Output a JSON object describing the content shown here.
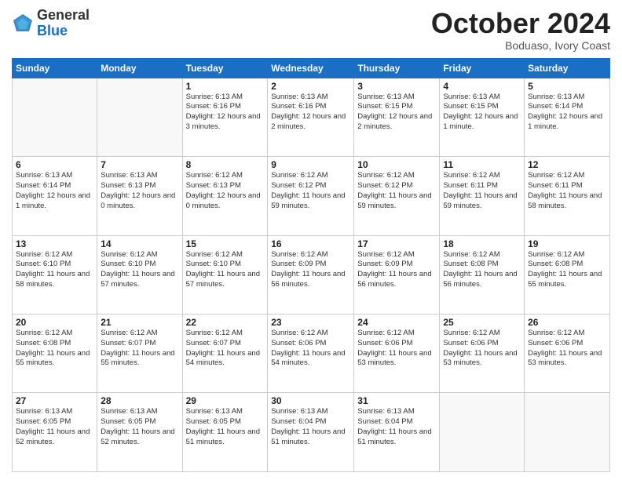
{
  "header": {
    "logo_general": "General",
    "logo_blue": "Blue",
    "month_title": "October 2024",
    "subtitle": "Boduaso, Ivory Coast"
  },
  "weekdays": [
    "Sunday",
    "Monday",
    "Tuesday",
    "Wednesday",
    "Thursday",
    "Friday",
    "Saturday"
  ],
  "weeks": [
    [
      {
        "day": "",
        "info": ""
      },
      {
        "day": "",
        "info": ""
      },
      {
        "day": "1",
        "info": "Sunrise: 6:13 AM\nSunset: 6:16 PM\nDaylight: 12 hours and 3 minutes."
      },
      {
        "day": "2",
        "info": "Sunrise: 6:13 AM\nSunset: 6:16 PM\nDaylight: 12 hours and 2 minutes."
      },
      {
        "day": "3",
        "info": "Sunrise: 6:13 AM\nSunset: 6:15 PM\nDaylight: 12 hours and 2 minutes."
      },
      {
        "day": "4",
        "info": "Sunrise: 6:13 AM\nSunset: 6:15 PM\nDaylight: 12 hours and 1 minute."
      },
      {
        "day": "5",
        "info": "Sunrise: 6:13 AM\nSunset: 6:14 PM\nDaylight: 12 hours and 1 minute."
      }
    ],
    [
      {
        "day": "6",
        "info": "Sunrise: 6:13 AM\nSunset: 6:14 PM\nDaylight: 12 hours and 1 minute."
      },
      {
        "day": "7",
        "info": "Sunrise: 6:13 AM\nSunset: 6:13 PM\nDaylight: 12 hours and 0 minutes."
      },
      {
        "day": "8",
        "info": "Sunrise: 6:12 AM\nSunset: 6:13 PM\nDaylight: 12 hours and 0 minutes."
      },
      {
        "day": "9",
        "info": "Sunrise: 6:12 AM\nSunset: 6:12 PM\nDaylight: 11 hours and 59 minutes."
      },
      {
        "day": "10",
        "info": "Sunrise: 6:12 AM\nSunset: 6:12 PM\nDaylight: 11 hours and 59 minutes."
      },
      {
        "day": "11",
        "info": "Sunrise: 6:12 AM\nSunset: 6:11 PM\nDaylight: 11 hours and 59 minutes."
      },
      {
        "day": "12",
        "info": "Sunrise: 6:12 AM\nSunset: 6:11 PM\nDaylight: 11 hours and 58 minutes."
      }
    ],
    [
      {
        "day": "13",
        "info": "Sunrise: 6:12 AM\nSunset: 6:10 PM\nDaylight: 11 hours and 58 minutes."
      },
      {
        "day": "14",
        "info": "Sunrise: 6:12 AM\nSunset: 6:10 PM\nDaylight: 11 hours and 57 minutes."
      },
      {
        "day": "15",
        "info": "Sunrise: 6:12 AM\nSunset: 6:10 PM\nDaylight: 11 hours and 57 minutes."
      },
      {
        "day": "16",
        "info": "Sunrise: 6:12 AM\nSunset: 6:09 PM\nDaylight: 11 hours and 56 minutes."
      },
      {
        "day": "17",
        "info": "Sunrise: 6:12 AM\nSunset: 6:09 PM\nDaylight: 11 hours and 56 minutes."
      },
      {
        "day": "18",
        "info": "Sunrise: 6:12 AM\nSunset: 6:08 PM\nDaylight: 11 hours and 56 minutes."
      },
      {
        "day": "19",
        "info": "Sunrise: 6:12 AM\nSunset: 6:08 PM\nDaylight: 11 hours and 55 minutes."
      }
    ],
    [
      {
        "day": "20",
        "info": "Sunrise: 6:12 AM\nSunset: 6:08 PM\nDaylight: 11 hours and 55 minutes."
      },
      {
        "day": "21",
        "info": "Sunrise: 6:12 AM\nSunset: 6:07 PM\nDaylight: 11 hours and 55 minutes."
      },
      {
        "day": "22",
        "info": "Sunrise: 6:12 AM\nSunset: 6:07 PM\nDaylight: 11 hours and 54 minutes."
      },
      {
        "day": "23",
        "info": "Sunrise: 6:12 AM\nSunset: 6:06 PM\nDaylight: 11 hours and 54 minutes."
      },
      {
        "day": "24",
        "info": "Sunrise: 6:12 AM\nSunset: 6:06 PM\nDaylight: 11 hours and 53 minutes."
      },
      {
        "day": "25",
        "info": "Sunrise: 6:12 AM\nSunset: 6:06 PM\nDaylight: 11 hours and 53 minutes."
      },
      {
        "day": "26",
        "info": "Sunrise: 6:12 AM\nSunset: 6:06 PM\nDaylight: 11 hours and 53 minutes."
      }
    ],
    [
      {
        "day": "27",
        "info": "Sunrise: 6:13 AM\nSunset: 6:05 PM\nDaylight: 11 hours and 52 minutes."
      },
      {
        "day": "28",
        "info": "Sunrise: 6:13 AM\nSunset: 6:05 PM\nDaylight: 11 hours and 52 minutes."
      },
      {
        "day": "29",
        "info": "Sunrise: 6:13 AM\nSunset: 6:05 PM\nDaylight: 11 hours and 51 minutes."
      },
      {
        "day": "30",
        "info": "Sunrise: 6:13 AM\nSunset: 6:04 PM\nDaylight: 11 hours and 51 minutes."
      },
      {
        "day": "31",
        "info": "Sunrise: 6:13 AM\nSunset: 6:04 PM\nDaylight: 11 hours and 51 minutes."
      },
      {
        "day": "",
        "info": ""
      },
      {
        "day": "",
        "info": ""
      }
    ]
  ]
}
